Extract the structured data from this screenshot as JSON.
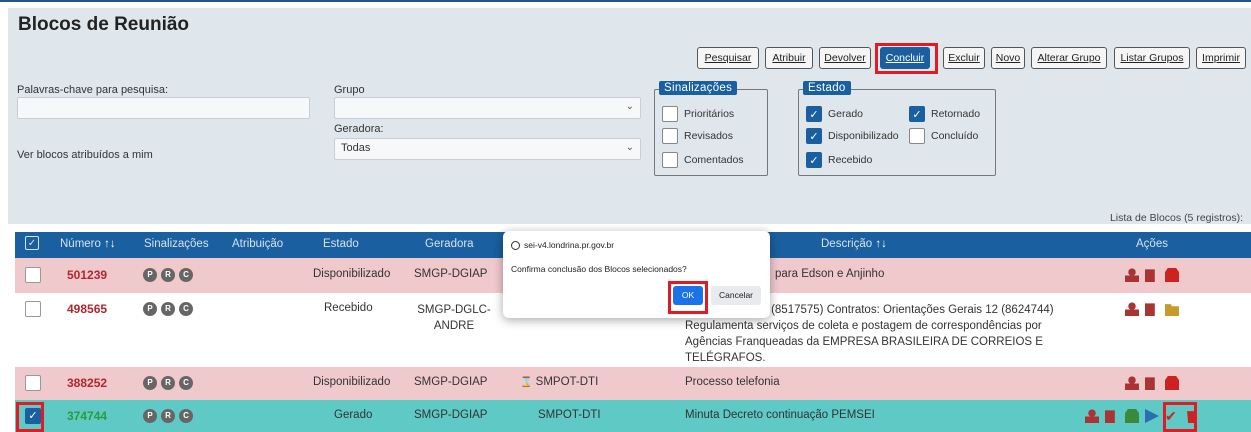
{
  "page": {
    "title": "Blocos de Reunião"
  },
  "toolbar": {
    "buttons": [
      "Pesquisar",
      "Atribuir",
      "Devolver",
      "Concluir",
      "Excluir",
      "Novo",
      "Alterar Grupo",
      "Listar Grupos",
      "Imprimir"
    ]
  },
  "search": {
    "keywords_label": "Palavras-chave para pesquisa:",
    "keywords_value": "",
    "assigned_label": "Ver blocos atribuídos a mim",
    "group_label": "Grupo",
    "group_value": "",
    "generator_label": "Geradora:",
    "generator_value": "Todas"
  },
  "signals": {
    "legend": "Sinalizações",
    "items": [
      {
        "label": "Prioritários",
        "checked": false
      },
      {
        "label": "Revisados",
        "checked": false
      },
      {
        "label": "Comentados",
        "checked": false
      }
    ]
  },
  "state": {
    "legend": "Estado",
    "items": [
      {
        "label": "Gerado",
        "checked": true
      },
      {
        "label": "Retornado",
        "checked": true
      },
      {
        "label": "Disponibilizado",
        "checked": true
      },
      {
        "label": "Concluído",
        "checked": false
      },
      {
        "label": "Recebido",
        "checked": true
      }
    ]
  },
  "list_info": "Lista de Blocos (5 registros):",
  "table": {
    "headers": {
      "number": "Número",
      "signals": "Sinalizações",
      "assignment": "Atribuição",
      "state": "Estado",
      "generator": "Geradora",
      "description": "Descrição",
      "actions": "Ações"
    },
    "sort_glyph": "↑↓",
    "signal_letters": [
      "P",
      "R",
      "C"
    ],
    "rows": [
      {
        "number": "501239",
        "state": "Disponibilizado",
        "generator": "SMGP-DGIAP",
        "unit": "",
        "description": "para Edson e Anjinho",
        "selected": false
      },
      {
        "number": "498565",
        "state": "Recebido",
        "generator": "SMGP-DGLC-ANDRE",
        "unit": "",
        "description": "ações Gerais 11 (8517575) Contratos: Orientações Gerais 12 (8624744) Regulamenta serviços de coleta e postagem de correspondências por Agências Franqueadas da EMPRESA BRASILEIRA DE CORREIOS E TELÉGRAFOS.",
        "selected": false
      },
      {
        "number": "388252",
        "state": "Disponibilizado",
        "generator": "SMGP-DGIAP",
        "unit": "SMPOT-DTI",
        "description": "Processo telefonia",
        "selected": false
      },
      {
        "number": "374744",
        "state": "Gerado",
        "generator": "SMGP-DGIAP",
        "unit": "SMPOT-DTI",
        "description": "Minuta Decreto continuação PEMSEI",
        "selected": true
      }
    ]
  },
  "dialog": {
    "origin": "sei-v4.londrina.pr.gov.br",
    "message": "Confirma conclusão dos Blocos selecionados?",
    "ok": "OK",
    "cancel": "Cancelar"
  },
  "colors": {
    "accent": "#1a5fa0",
    "highlight": "#e01b24",
    "row_pink": "#f0c9cd",
    "row_teal": "#5ec9c5"
  }
}
